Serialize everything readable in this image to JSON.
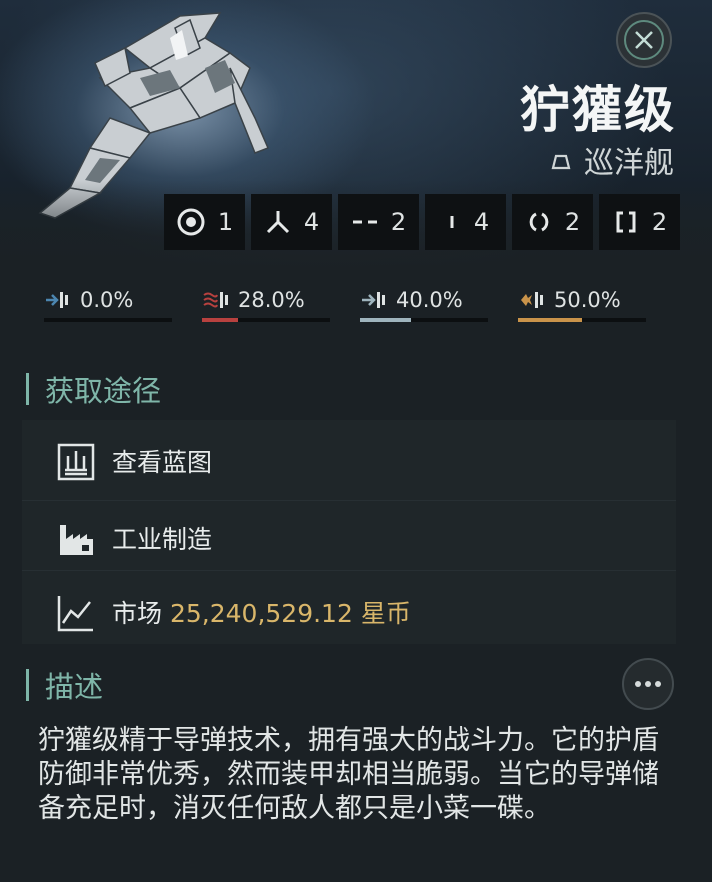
{
  "ship": {
    "name": "狞獾级",
    "class_label": "巡洋舰"
  },
  "slots": [
    {
      "icon": "turret-hardpoint-icon",
      "count": "1"
    },
    {
      "icon": "launcher-hardpoint-icon",
      "count": "4"
    },
    {
      "icon": "high-slot-icon",
      "count": "2"
    },
    {
      "icon": "low-slot-icon",
      "count": "4"
    },
    {
      "icon": "mid-slot-icon",
      "count": "2"
    },
    {
      "icon": "rig-slot-icon",
      "count": "2"
    }
  ],
  "resistances": [
    {
      "type": "em",
      "value": "0.0%",
      "fraction": 0.0,
      "color": "#4c86b0"
    },
    {
      "type": "thermal",
      "value": "28.0%",
      "fraction": 0.28,
      "color": "#b8413f"
    },
    {
      "type": "kinetic",
      "value": "40.0%",
      "fraction": 0.4,
      "color": "#9fb4bd"
    },
    {
      "type": "explosive",
      "value": "50.0%",
      "fraction": 0.5,
      "color": "#c9934a"
    }
  ],
  "acquire": {
    "title": "获取途径",
    "blueprint_label": "查看蓝图",
    "industry_label": "工业制造",
    "market_label": "市场",
    "market_price": "25,240,529.12 星币"
  },
  "description": {
    "title": "描述",
    "text": "狞獾级精于导弹技术，拥有强大的战斗力。它的护盾防御非常优秀，然而装甲却相当脆弱。当它的导弹储备充足时，消灭任何敌人都只是小菜一碟。"
  },
  "colors": {
    "accent": "#7fb6a9",
    "price": "#d9b66a"
  }
}
